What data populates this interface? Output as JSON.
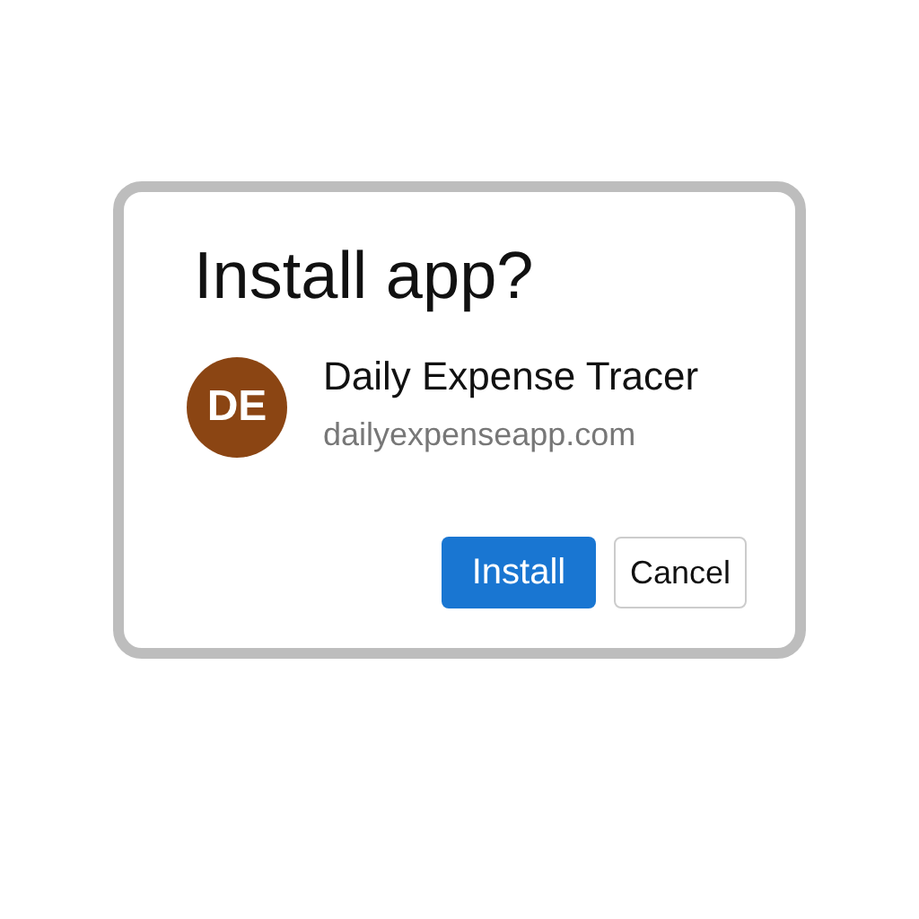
{
  "dialog": {
    "title": "Install app?",
    "app": {
      "initials": "DE",
      "name": "Daily Expense Tracer",
      "domain": "dailyexpenseapp.com"
    },
    "buttons": [
      {
        "label": "Install",
        "kind": "primary"
      },
      {
        "label": "Cancel",
        "kind": "secondary"
      }
    ]
  }
}
